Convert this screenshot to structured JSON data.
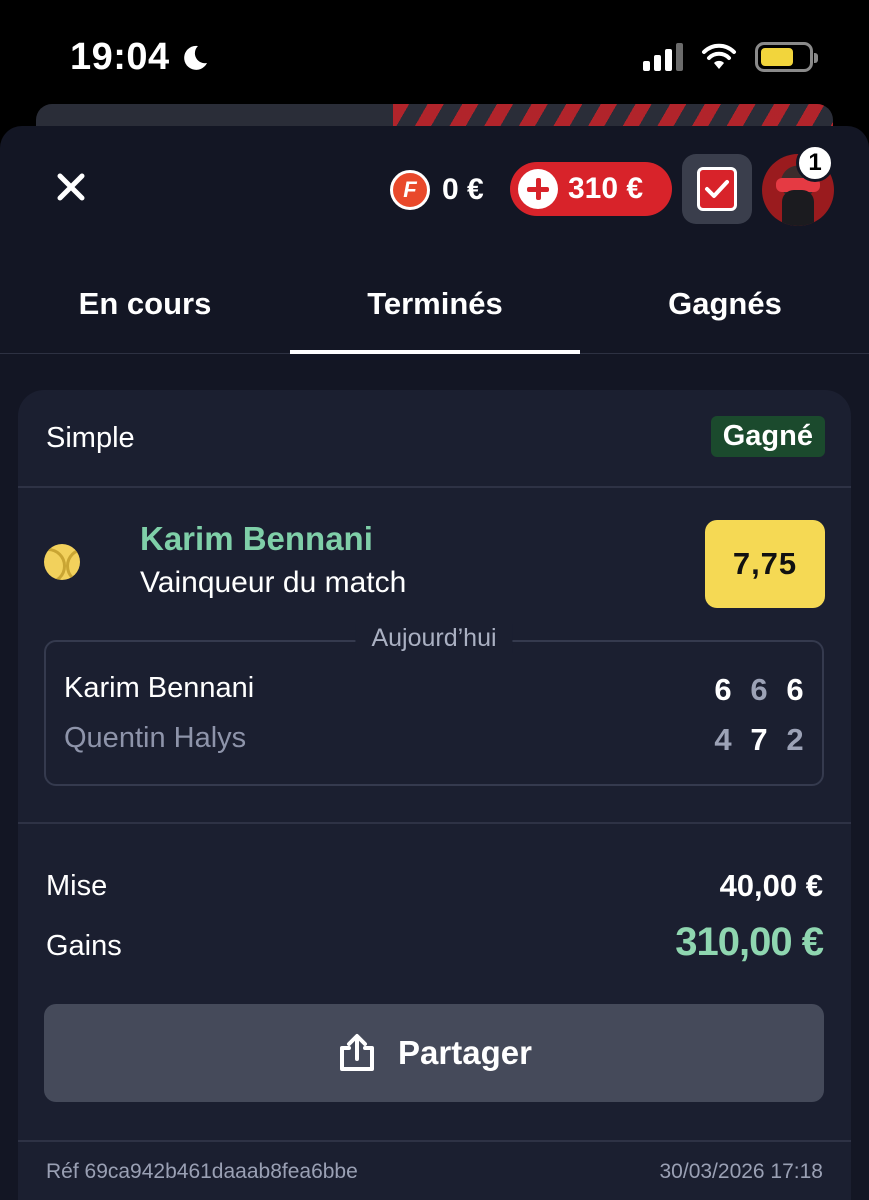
{
  "statusbar": {
    "time": "19:04"
  },
  "header": {
    "freebet_amount": "0 €",
    "balance": "310 €",
    "notification_count": "1"
  },
  "tabs": [
    {
      "label": "En cours"
    },
    {
      "label": "Terminés"
    },
    {
      "label": "Gagnés"
    }
  ],
  "bet": {
    "type": "Simple",
    "status": "Gagné",
    "selection": {
      "name": "Karim Bennani",
      "market": "Vainqueur du match",
      "odds": "7,75"
    },
    "match": {
      "date_label": "Aujourd’hui",
      "players": [
        {
          "name": "Karim Bennani",
          "scores": [
            "6",
            "6",
            "6"
          ]
        },
        {
          "name": "Quentin Halys",
          "scores": [
            "4",
            "7",
            "2"
          ]
        }
      ]
    },
    "stake_label": "Mise",
    "stake_value": "40,00 €",
    "gains_label": "Gains",
    "gains_value": "310,00 €",
    "share_label": "Partager",
    "reference": "Réf 69ca942b461daaab8fea6bbe",
    "datetime": "30/03/2026 17:18"
  },
  "colors": {
    "accent_red": "#d8232a",
    "win_green": "#7fcfa8",
    "odds_yellow": "#f5d954",
    "background": "#131624"
  }
}
